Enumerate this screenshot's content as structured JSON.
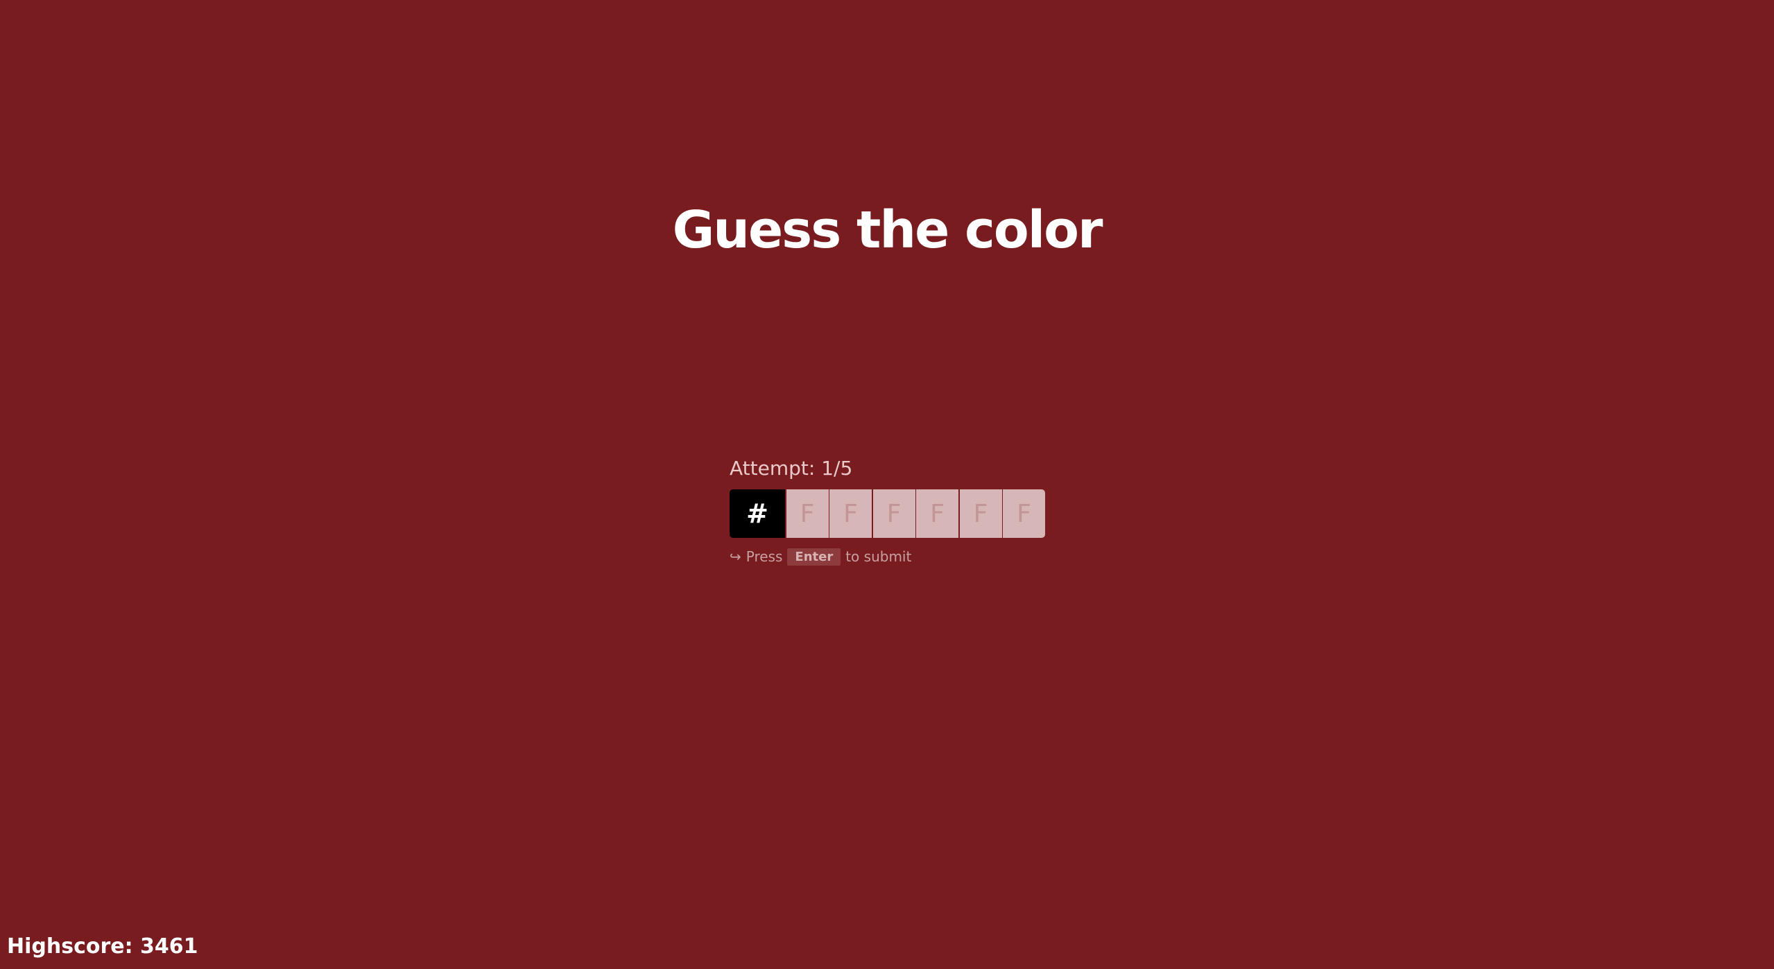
{
  "title": "Guess the color",
  "attempt": {
    "label": "Attempt: 1/5"
  },
  "input": {
    "prefix": "#",
    "placeholder_chars": [
      "F",
      "F",
      "F",
      "F",
      "F",
      "F"
    ]
  },
  "hint": {
    "arrow": "↪",
    "press": "Press",
    "key": "Enter",
    "suffix": "to submit"
  },
  "highscore": {
    "label": "Highscore: 3461"
  },
  "colors": {
    "background": "#781c1f",
    "prefix_bg": "#000000",
    "cell_bg": "#d6b6b7"
  },
  "icons": {
    "submit_hint_icon": "return-arrow-icon"
  }
}
